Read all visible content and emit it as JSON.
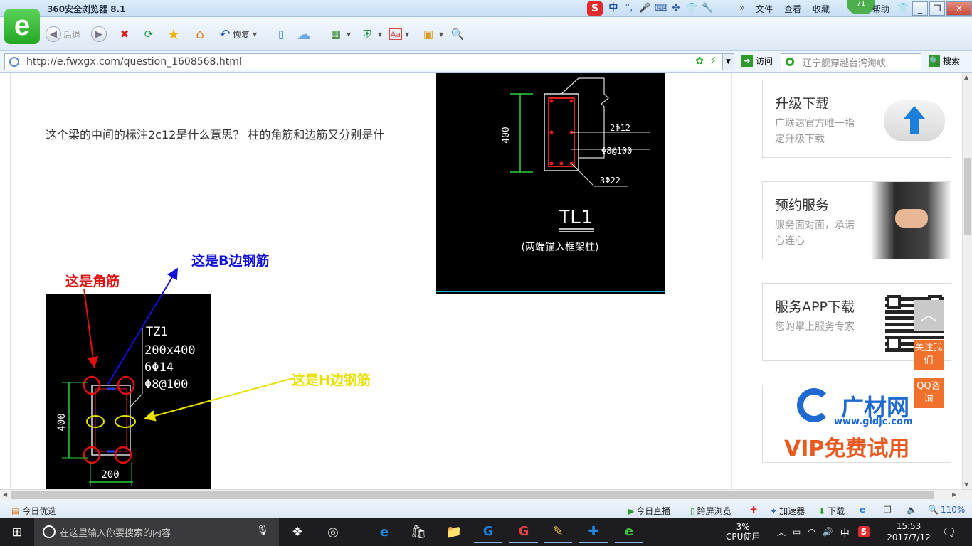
{
  "window": {
    "title": "360安全浏览器 8.1",
    "menu": [
      "文件",
      "查看",
      "收藏",
      "帮助"
    ],
    "badge": "71",
    "ime_mode": "中"
  },
  "toolbar": {
    "back_label": "后退",
    "restore_label": "恢复"
  },
  "address": {
    "url": "http://e.fwxgx.com/question_1608568.html",
    "visit_label": "访问",
    "search_placeholder": "辽宁舰穿越台湾海峡",
    "search_label": "搜索"
  },
  "question": {
    "text": "这个梁的中间的标注2c12是什么意思？   柱的角筋和边筋又分别是什"
  },
  "cad_beam": {
    "dim_height": "400",
    "rebar_top": "2Φ12",
    "stirrup": "Φ8@100",
    "rebar_bottom": "3Φ22",
    "name": "TL1",
    "note": "(两端锚入框架柱)"
  },
  "cad_column": {
    "name": "TZ1",
    "size": "200x400",
    "rebar": "6Φ14",
    "stirrup": "Φ8@100",
    "dim_height": "400",
    "dim_width": "200"
  },
  "annotations": {
    "corner": "这是角筋",
    "b_side": "这是B边钢筋",
    "h_side": "这是H边钢筋",
    "colors": {
      "corner": "#e01010",
      "b_side": "#1010d8",
      "h_side": "#e8e000"
    }
  },
  "sidebar": {
    "cards": [
      {
        "title": "升级下载",
        "desc": "广联达官方唯一指定升级下载"
      },
      {
        "title": "预约服务",
        "desc": "服务面对面，承诺心连心"
      },
      {
        "title": "服务APP下载",
        "desc": "您的掌上服务专家"
      }
    ],
    "ad": {
      "brand": "广材网",
      "site": "www.gldjc.com",
      "slogan": "VIP免费试用"
    },
    "float_follow": "关注我们",
    "float_qq": "QQ咨询"
  },
  "statusbar": {
    "today_pick": "今日优选",
    "live": "今日直播",
    "cross_screen": "跨屏浏览",
    "accelerator": "加速器",
    "download": "下载",
    "zoom": "110%"
  },
  "taskbar": {
    "search_placeholder": "在这里输入你要搜索的内容",
    "cpu_value": "3%",
    "cpu_label": "CPU使用",
    "ime": "中",
    "time": "15:53",
    "date": "2017/7/12"
  }
}
